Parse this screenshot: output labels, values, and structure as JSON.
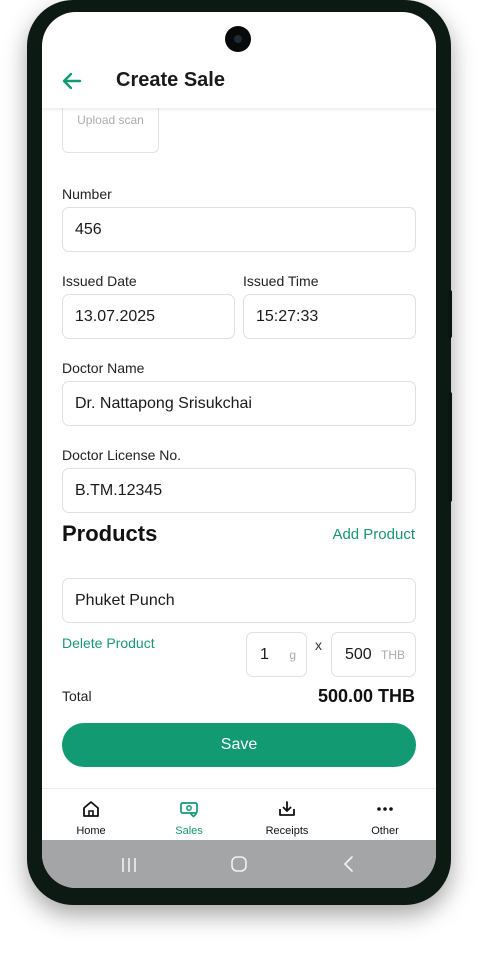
{
  "header": {
    "title": "Create Sale"
  },
  "upload": {
    "label": "Upload scan"
  },
  "form": {
    "number": {
      "label": "Number",
      "value": "456"
    },
    "issued_date": {
      "label": "Issued Date",
      "value": "13.07.2025"
    },
    "issued_time": {
      "label": "Issued Time",
      "value": "15:27:33"
    },
    "doctor_name": {
      "label": "Doctor Name",
      "value": "Dr. Nattapong Srisukchai"
    },
    "doctor_license": {
      "label": "Doctor License No.",
      "value": "B.TM.12345"
    }
  },
  "products": {
    "title": "Products",
    "add_label": "Add Product",
    "items": [
      {
        "name": "Phuket Punch",
        "delete_label": "Delete Product",
        "quantity": "1",
        "quantity_unit": "g",
        "times": "x",
        "price": "500",
        "price_unit": "THB"
      }
    ]
  },
  "total": {
    "label": "Total",
    "value": "500.00 THB"
  },
  "save_label": "Save",
  "nav": {
    "items": [
      {
        "label": "Home",
        "icon": "home-icon"
      },
      {
        "label": "Sales",
        "icon": "sales-icon",
        "active": true
      },
      {
        "label": "Receipts",
        "icon": "receipts-icon"
      },
      {
        "label": "Other",
        "icon": "more-icon"
      }
    ]
  },
  "colors": {
    "accent": "#129a72",
    "phone_frame": "#0d1a14",
    "system_nav": "#a4a5a6"
  }
}
